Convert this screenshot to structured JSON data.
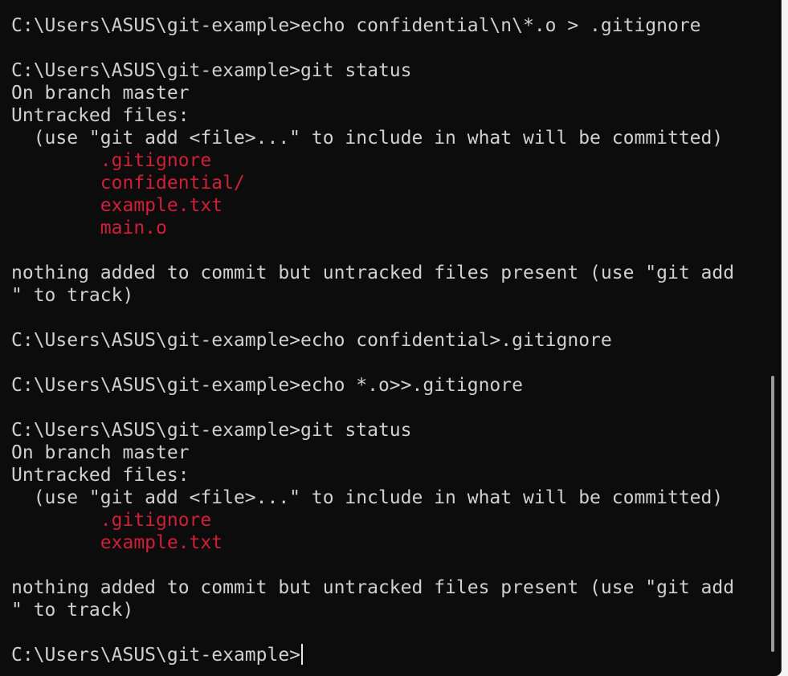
{
  "terminal": {
    "lines": [
      {
        "text": "C:\\Users\\ASUS\\git-example>echo confidential\\n\\*.o > .gitignore",
        "kind": "command"
      },
      {
        "text": "",
        "kind": "blank"
      },
      {
        "text": "C:\\Users\\ASUS\\git-example>git status",
        "kind": "command"
      },
      {
        "text": "On branch master",
        "kind": "output"
      },
      {
        "text": "Untracked files:",
        "kind": "output"
      },
      {
        "text": "  (use \"git add <file>...\" to include in what will be committed)",
        "kind": "output"
      },
      {
        "text": "        .gitignore",
        "kind": "untracked"
      },
      {
        "text": "        confidential/",
        "kind": "untracked"
      },
      {
        "text": "        example.txt",
        "kind": "untracked"
      },
      {
        "text": "        main.o",
        "kind": "untracked"
      },
      {
        "text": "",
        "kind": "blank"
      },
      {
        "text": "nothing added to commit but untracked files present (use \"git add",
        "kind": "output"
      },
      {
        "text": "\" to track)",
        "kind": "output"
      },
      {
        "text": "",
        "kind": "blank"
      },
      {
        "text": "C:\\Users\\ASUS\\git-example>echo confidential>.gitignore",
        "kind": "command"
      },
      {
        "text": "",
        "kind": "blank"
      },
      {
        "text": "C:\\Users\\ASUS\\git-example>echo *.o>>.gitignore",
        "kind": "command"
      },
      {
        "text": "",
        "kind": "blank"
      },
      {
        "text": "C:\\Users\\ASUS\\git-example>git status",
        "kind": "command"
      },
      {
        "text": "On branch master",
        "kind": "output"
      },
      {
        "text": "Untracked files:",
        "kind": "output"
      },
      {
        "text": "  (use \"git add <file>...\" to include in what will be committed)",
        "kind": "output"
      },
      {
        "text": "        .gitignore",
        "kind": "untracked"
      },
      {
        "text": "        example.txt",
        "kind": "untracked"
      },
      {
        "text": "",
        "kind": "blank"
      },
      {
        "text": "nothing added to commit but untracked files present (use \"git add",
        "kind": "output"
      },
      {
        "text": "\" to track)",
        "kind": "output"
      },
      {
        "text": "",
        "kind": "blank"
      }
    ],
    "prompt": "C:\\Users\\ASUS\\git-example>",
    "colors": {
      "background": "#0c0c0c",
      "foreground": "#d0d0d0",
      "untracked": "#d02038"
    }
  }
}
